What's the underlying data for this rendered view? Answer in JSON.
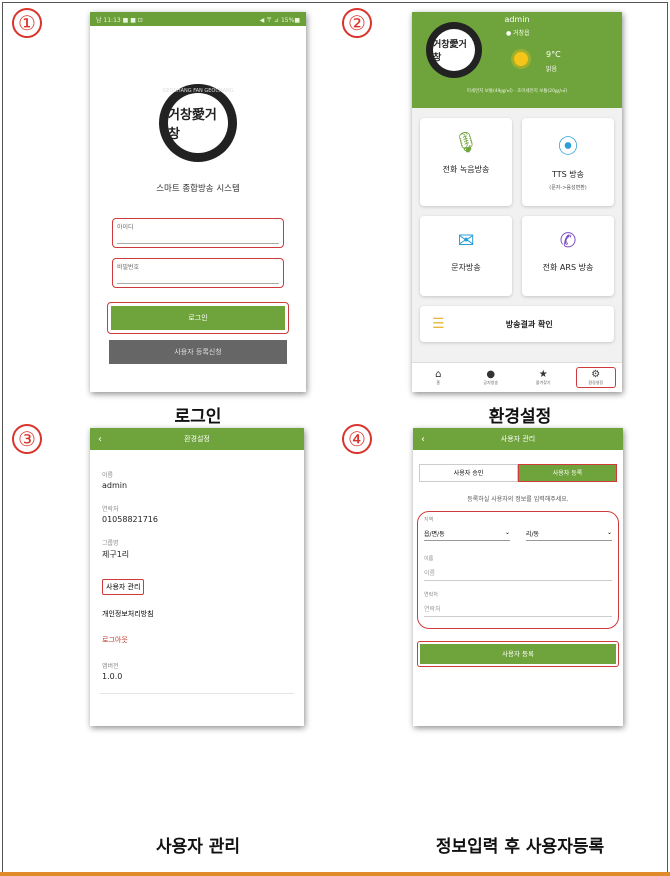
{
  "captions": {
    "c1": "로그인",
    "c2": "환경설정",
    "c3": "사용자 관리",
    "c4": "정보입력 후 사용자등록"
  },
  "steps": {
    "s1": "①",
    "s2": "②",
    "s3": "③",
    "s4": "④"
  },
  "login": {
    "status_left": "남 11:13 ■ ■ ⊡",
    "status_right": "◀ 〒 ⊿ 15%■",
    "logo_text": "거창愛거창",
    "logo_ring": "GEOCHANG FAN GEOCHANG",
    "title": "스마트 종합방송 시스템",
    "id_label": "아이디",
    "pw_label": "비밀번호",
    "login_button": "로그인",
    "register_button": "사용자 등록신청"
  },
  "home": {
    "user": "admin",
    "location": "● 거창읍",
    "temp": "9°C",
    "weather": "맑음",
    "info_line": "미세먼지 보통(49㎍/㎥) · 초미세먼지 보통(20㎍/㎥)",
    "tiles": [
      {
        "label": "전화 녹음방송",
        "sub": "",
        "icon": "🎙",
        "color": "#6fa33b"
      },
      {
        "label": "TTS 방송",
        "sub": "(문자->음성변환)",
        "icon": "⦿",
        "color": "#2b9fd8"
      },
      {
        "label": "문자방송",
        "sub": "",
        "icon": "✉",
        "color": "#2b9fd8"
      },
      {
        "label": "전화 ARS 방송",
        "sub": "",
        "icon": "✆",
        "color": "#7b4fc4"
      }
    ],
    "result": "방송결과 확인",
    "nav": [
      "홈",
      "공지방송",
      "즐겨찾기",
      "환경설정"
    ]
  },
  "settings": {
    "title": "환경설정",
    "items": [
      {
        "label": "이름",
        "value": "admin"
      },
      {
        "label": "연락처",
        "value": "01058821716"
      },
      {
        "label": "그룹명",
        "value": "제구1리"
      }
    ],
    "user_mgmt": "사용자 관리",
    "privacy": "개인정보처리방침",
    "logout": "로그아웃",
    "version_label": "앱버전",
    "version": "1.0.0"
  },
  "usermgmt": {
    "title": "사용자 관리",
    "tab_approve": "사용자 승인",
    "tab_register": "사용자 등록",
    "guide": "등록하실 사용자의 정보를 입력해주세요.",
    "region_label": "지역",
    "region1": "읍/면/동",
    "region2": "리/동",
    "name_label": "이름",
    "name_ph": "이름",
    "phone_label": "연락처",
    "phone_ph": "연락처",
    "submit": "사용자 등록"
  }
}
